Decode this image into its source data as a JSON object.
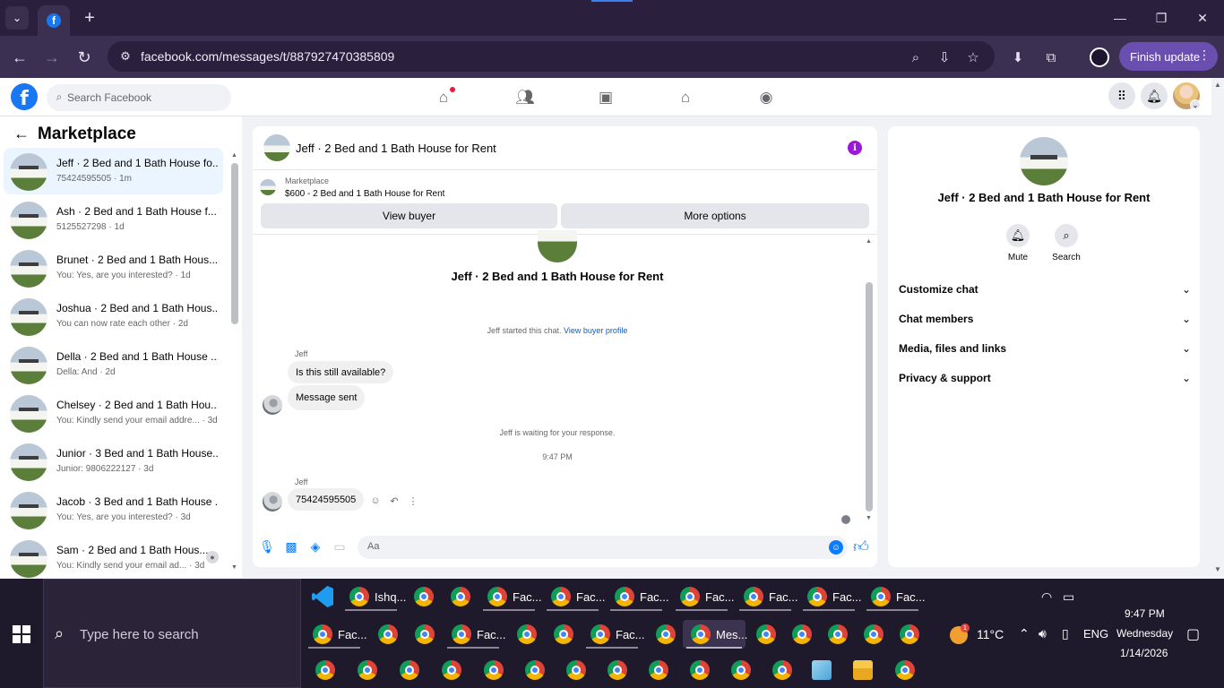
{
  "browser": {
    "url": "facebook.com/messages/t/887927470385809",
    "finish_update": "Finish update"
  },
  "fb": {
    "search_placeholder": "Search Facebook"
  },
  "sidebar": {
    "title": "Marketplace",
    "conversations": [
      {
        "name": "Jeff · 2 Bed and 1 Bath House fo...",
        "sub": "75424595505 · 1m"
      },
      {
        "name": "Ash · 2 Bed and 1 Bath House f...",
        "sub": "5125527298 · 1d"
      },
      {
        "name": "Brunet · 2 Bed and 1 Bath Hous...",
        "sub": "You: Yes, are you interested? · 1d"
      },
      {
        "name": "Joshua · 2 Bed and 1 Bath Hous...",
        "sub": "You can now rate each other · 2d"
      },
      {
        "name": "Della · 2 Bed and 1 Bath House ...",
        "sub": "Della: And · 2d"
      },
      {
        "name": "Chelsey · 2 Bed and 1 Bath Hou...",
        "sub": "You: Kindly send your email addre... · 3d"
      },
      {
        "name": "Junior · 3 Bed and 1 Bath House...",
        "sub": "Junior: 9806222127 · 3d"
      },
      {
        "name": "Jacob · 3 Bed and 1 Bath House ...",
        "sub": "You: Yes, are you interested? · 3d"
      },
      {
        "name": "Sam · 2 Bed and 1 Bath Hous...",
        "sub": "You: Kindly send your email ad... · 3d"
      }
    ]
  },
  "chat": {
    "title": "Jeff · 2 Bed and 1 Bath House for Rent",
    "marketplace_label": "Marketplace",
    "listing": "$600 - 2 Bed and 1 Bath House for Rent",
    "view_buyer": "View buyer",
    "more_options": "More options",
    "center_name": "Jeff · 2 Bed and 1 Bath House for Rent",
    "started_text": "Jeff started this chat.",
    "view_buyer_profile": "View buyer profile",
    "sender1": "Jeff",
    "msg1": "Is this still available?",
    "msg2": "Message sent",
    "waiting_text": "Jeff is waiting for your response.",
    "time_divider": "9:47 PM",
    "sender2": "Jeff",
    "msg3": "75424595505",
    "composer_placeholder": "Aa"
  },
  "info": {
    "title": "Jeff · 2 Bed and 1 Bath House for Rent",
    "mute": "Mute",
    "search": "Search",
    "sections": [
      "Customize chat",
      "Chat members",
      "Media, files and links",
      "Privacy & support"
    ]
  },
  "taskbar": {
    "search_text": "Type here to search",
    "row1_labels": [
      "Ishq...",
      "Fac...",
      "Fac...",
      "Fac...",
      "Fac...",
      "Fac...",
      "Fac...",
      "Fac..."
    ],
    "row2_labels": [
      "Fac...",
      "Fac...",
      "Fac...",
      "Mes..."
    ],
    "weather_badge": "1",
    "temperature": "11°C",
    "language": "ENG",
    "time": "9:47 PM",
    "day": "Wednesday",
    "date": "1/14/2026"
  }
}
